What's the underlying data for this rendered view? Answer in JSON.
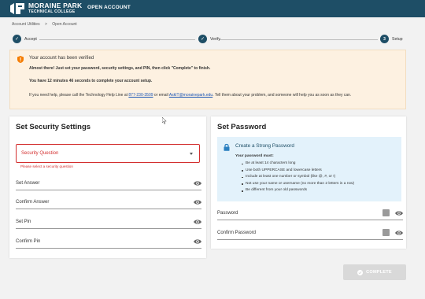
{
  "header": {
    "logo_line1": "MORAINE PARK",
    "logo_line2": "TECHNICAL COLLEGE",
    "app_title": "OPEN ACCOUNT",
    "brand_color": "#1e4e66"
  },
  "breadcrumb": {
    "items": [
      "Account Utilities",
      "Open Account"
    ],
    "separator": ">"
  },
  "stepper": {
    "steps": [
      {
        "label": "Accept",
        "state": "done",
        "icon": "check-icon"
      },
      {
        "label": "Verify",
        "state": "done",
        "icon": "check-icon"
      },
      {
        "label": "Setup",
        "state": "current",
        "number": "3"
      }
    ]
  },
  "alert": {
    "icon": "shield-warning-icon",
    "title": "Your account has been verified",
    "line1": "Almost there! Just set your password, security settings, and PIN, then click \"Complete\" to finish.",
    "line2": "You have 12 minutes 46 seconds to complete your account setup.",
    "help_prefix": "If you need help, please call the Technology Help Line at ",
    "help_phone": "877-230-3509",
    "help_mid": " or email ",
    "help_email": "AskIT@morainepark.edu",
    "help_suffix": ". Tell them about your problem, and someone will help you as soon as they can."
  },
  "security": {
    "title": "Set Security Settings",
    "question_label": "Security Question",
    "question_error": "Please select a security question",
    "fields": [
      {
        "label": "Set Answer"
      },
      {
        "label": "Confirm Answer"
      },
      {
        "label": "Set Pin"
      },
      {
        "label": "Confirm Pin"
      }
    ]
  },
  "password": {
    "title": "Set Password",
    "info_heading": "Create a Strong Password",
    "must_label": "Your password must:",
    "rules": [
      "Be at least 14 characters long",
      "Use both UPPERCASE and lowercase letters",
      "Include at least one number or symbol (like @, #, or !)",
      "Not use your name or username (no more than 2 letters in a row)",
      "Be different from your old passwords"
    ],
    "fields": [
      {
        "label": "Password"
      },
      {
        "label": "Confirm Password"
      }
    ]
  },
  "complete_button": {
    "label": "COMPLETE",
    "enabled": false
  },
  "colors": {
    "error": "#d32f2f",
    "alert_bg": "#fdf1e1",
    "info_bg": "#e3f2fb",
    "link": "#1a55b5"
  }
}
